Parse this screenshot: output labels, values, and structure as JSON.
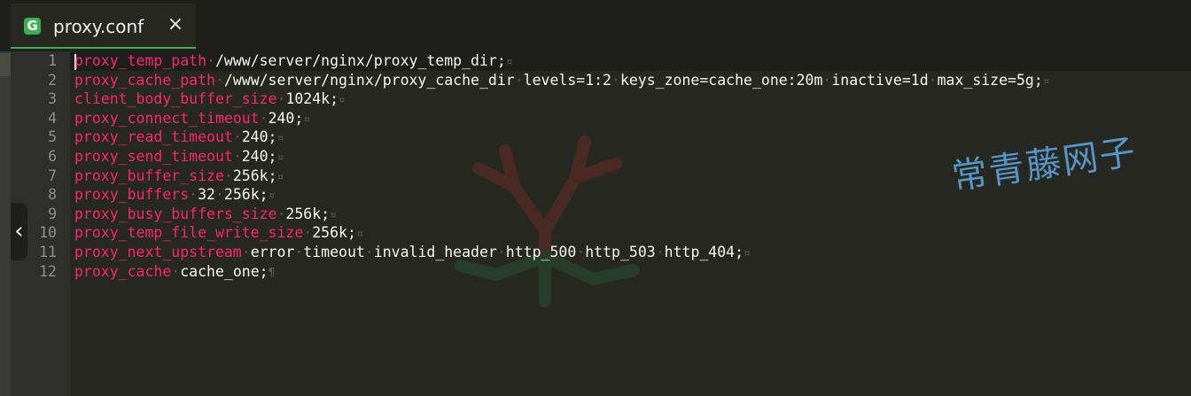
{
  "tab": {
    "icon": "G",
    "title": "proxy.conf",
    "close": "×"
  },
  "editor": {
    "collapse_icon": "‹",
    "eol_marker": "¤",
    "final_marker": "¶",
    "lines": [
      {
        "num": "1",
        "directive": "proxy_temp_path",
        "args": [
          "/www/server/nginx/proxy_temp_dir;"
        ]
      },
      {
        "num": "2",
        "directive": "proxy_cache_path",
        "args": [
          "/www/server/nginx/proxy_cache_dir",
          "levels=1:2",
          "keys_zone=cache_one:20m",
          "inactive=1d",
          "max_size=5g;"
        ]
      },
      {
        "num": "3",
        "directive": "client_body_buffer_size",
        "args": [
          "1024k;"
        ]
      },
      {
        "num": "4",
        "directive": "proxy_connect_timeout",
        "args": [
          "240;"
        ]
      },
      {
        "num": "5",
        "directive": "proxy_read_timeout",
        "args": [
          "240;"
        ]
      },
      {
        "num": "6",
        "directive": "proxy_send_timeout",
        "args": [
          "240;"
        ]
      },
      {
        "num": "7",
        "directive": "proxy_buffer_size",
        "args": [
          "256k;"
        ]
      },
      {
        "num": "8",
        "directive": "proxy_buffers",
        "args": [
          "32",
          "256k;"
        ]
      },
      {
        "num": "9",
        "directive": "proxy_busy_buffers_size",
        "args": [
          "256k;"
        ]
      },
      {
        "num": "10",
        "directive": "proxy_temp_file_write_size",
        "args": [
          "256k;"
        ]
      },
      {
        "num": "11",
        "directive": "proxy_next_upstream",
        "args": [
          "error",
          "timeout",
          "invalid_header",
          "http_500",
          "http_503",
          "http_404;"
        ]
      },
      {
        "num": "12",
        "directive": "proxy_cache",
        "args": [
          "cache_one;"
        ]
      }
    ]
  },
  "watermark": {
    "text": "常青藤网子"
  },
  "colors": {
    "background": "#272822",
    "keyword": "#f92672",
    "value": "#f8f8f2",
    "accent": "#3cb054",
    "watermark": "#5a9fd4"
  }
}
